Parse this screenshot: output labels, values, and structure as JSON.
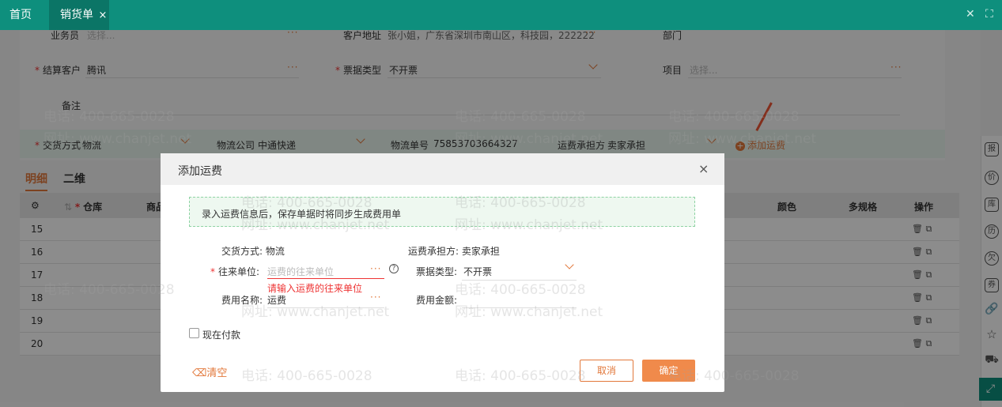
{
  "topbar": {
    "home_tab": "首页",
    "active_tab": "销货单",
    "close_glyph": "×",
    "icons": [
      "close-icon",
      "fullscreen-icon"
    ]
  },
  "form": {
    "salesperson_label": "业务员",
    "salesperson_placeholder": "选择...",
    "address_label": "客户地址",
    "address_value": "张小姐，广东省深圳市南山区，科技园，222222",
    "department_label": "部门",
    "settle_customer_label": "结算客户",
    "settle_customer_value": "腾讯",
    "invoice_type_label": "票据类型",
    "invoice_type_value": "不开票",
    "project_label": "项目",
    "project_placeholder": "选择...",
    "remark_label": "备注",
    "delivery_label": "交货方式",
    "delivery_value": "物流",
    "logistics_company_label": "物流公司",
    "logistics_company_value": "中通快递",
    "tracking_label": "物流单号",
    "tracking_value": "75853703664327",
    "freight_bearer_label": "运费承担方",
    "freight_bearer_value": "卖家承担",
    "add_freight_label": "添加运费",
    "dots": "···"
  },
  "subtabs": [
    "明细",
    "二维"
  ],
  "grid": {
    "headers": [
      "仓库",
      "商品",
      "颜色",
      "多规格",
      "操作"
    ],
    "rows": [
      "15",
      "16",
      "17",
      "18",
      "19",
      "20"
    ]
  },
  "sidebar": {
    "icons": [
      "报",
      "价",
      "库",
      "历",
      "欠",
      "券",
      "link-icon",
      "star-icon",
      "truck-icon",
      "file-icon",
      "trash-icon",
      "expand-icon"
    ]
  },
  "modal": {
    "title": "添加运费",
    "close_glyph": "×",
    "info_text": "录入运费信息后，保存单据时将同步生成费用单",
    "delivery_text": "交货方式: 物流",
    "bearer_text": "运费承担方: 卖家承担",
    "partner_label": "往来单位:",
    "partner_placeholder": "运费的往来单位",
    "partner_error": "请输入运费的往来单位",
    "invoice_label": "票据类型:",
    "invoice_value": "不开票",
    "fee_name_label": "费用名称:",
    "fee_name_value": "运费",
    "fee_amount_label": "费用金额:",
    "pay_now_label": "现在付款",
    "clear_label": "清空",
    "cancel_label": "取消",
    "ok_label": "确定",
    "dots": "···",
    "help_glyph": "?"
  },
  "watermarks": {
    "phone": "电话: 400-665-0028",
    "site": "网址: www.chanjet.net"
  },
  "colors": {
    "topbar": "#0e8f7d",
    "accent": "#e2783b",
    "ok_button": "#f08a4b",
    "error": "#e33333"
  }
}
